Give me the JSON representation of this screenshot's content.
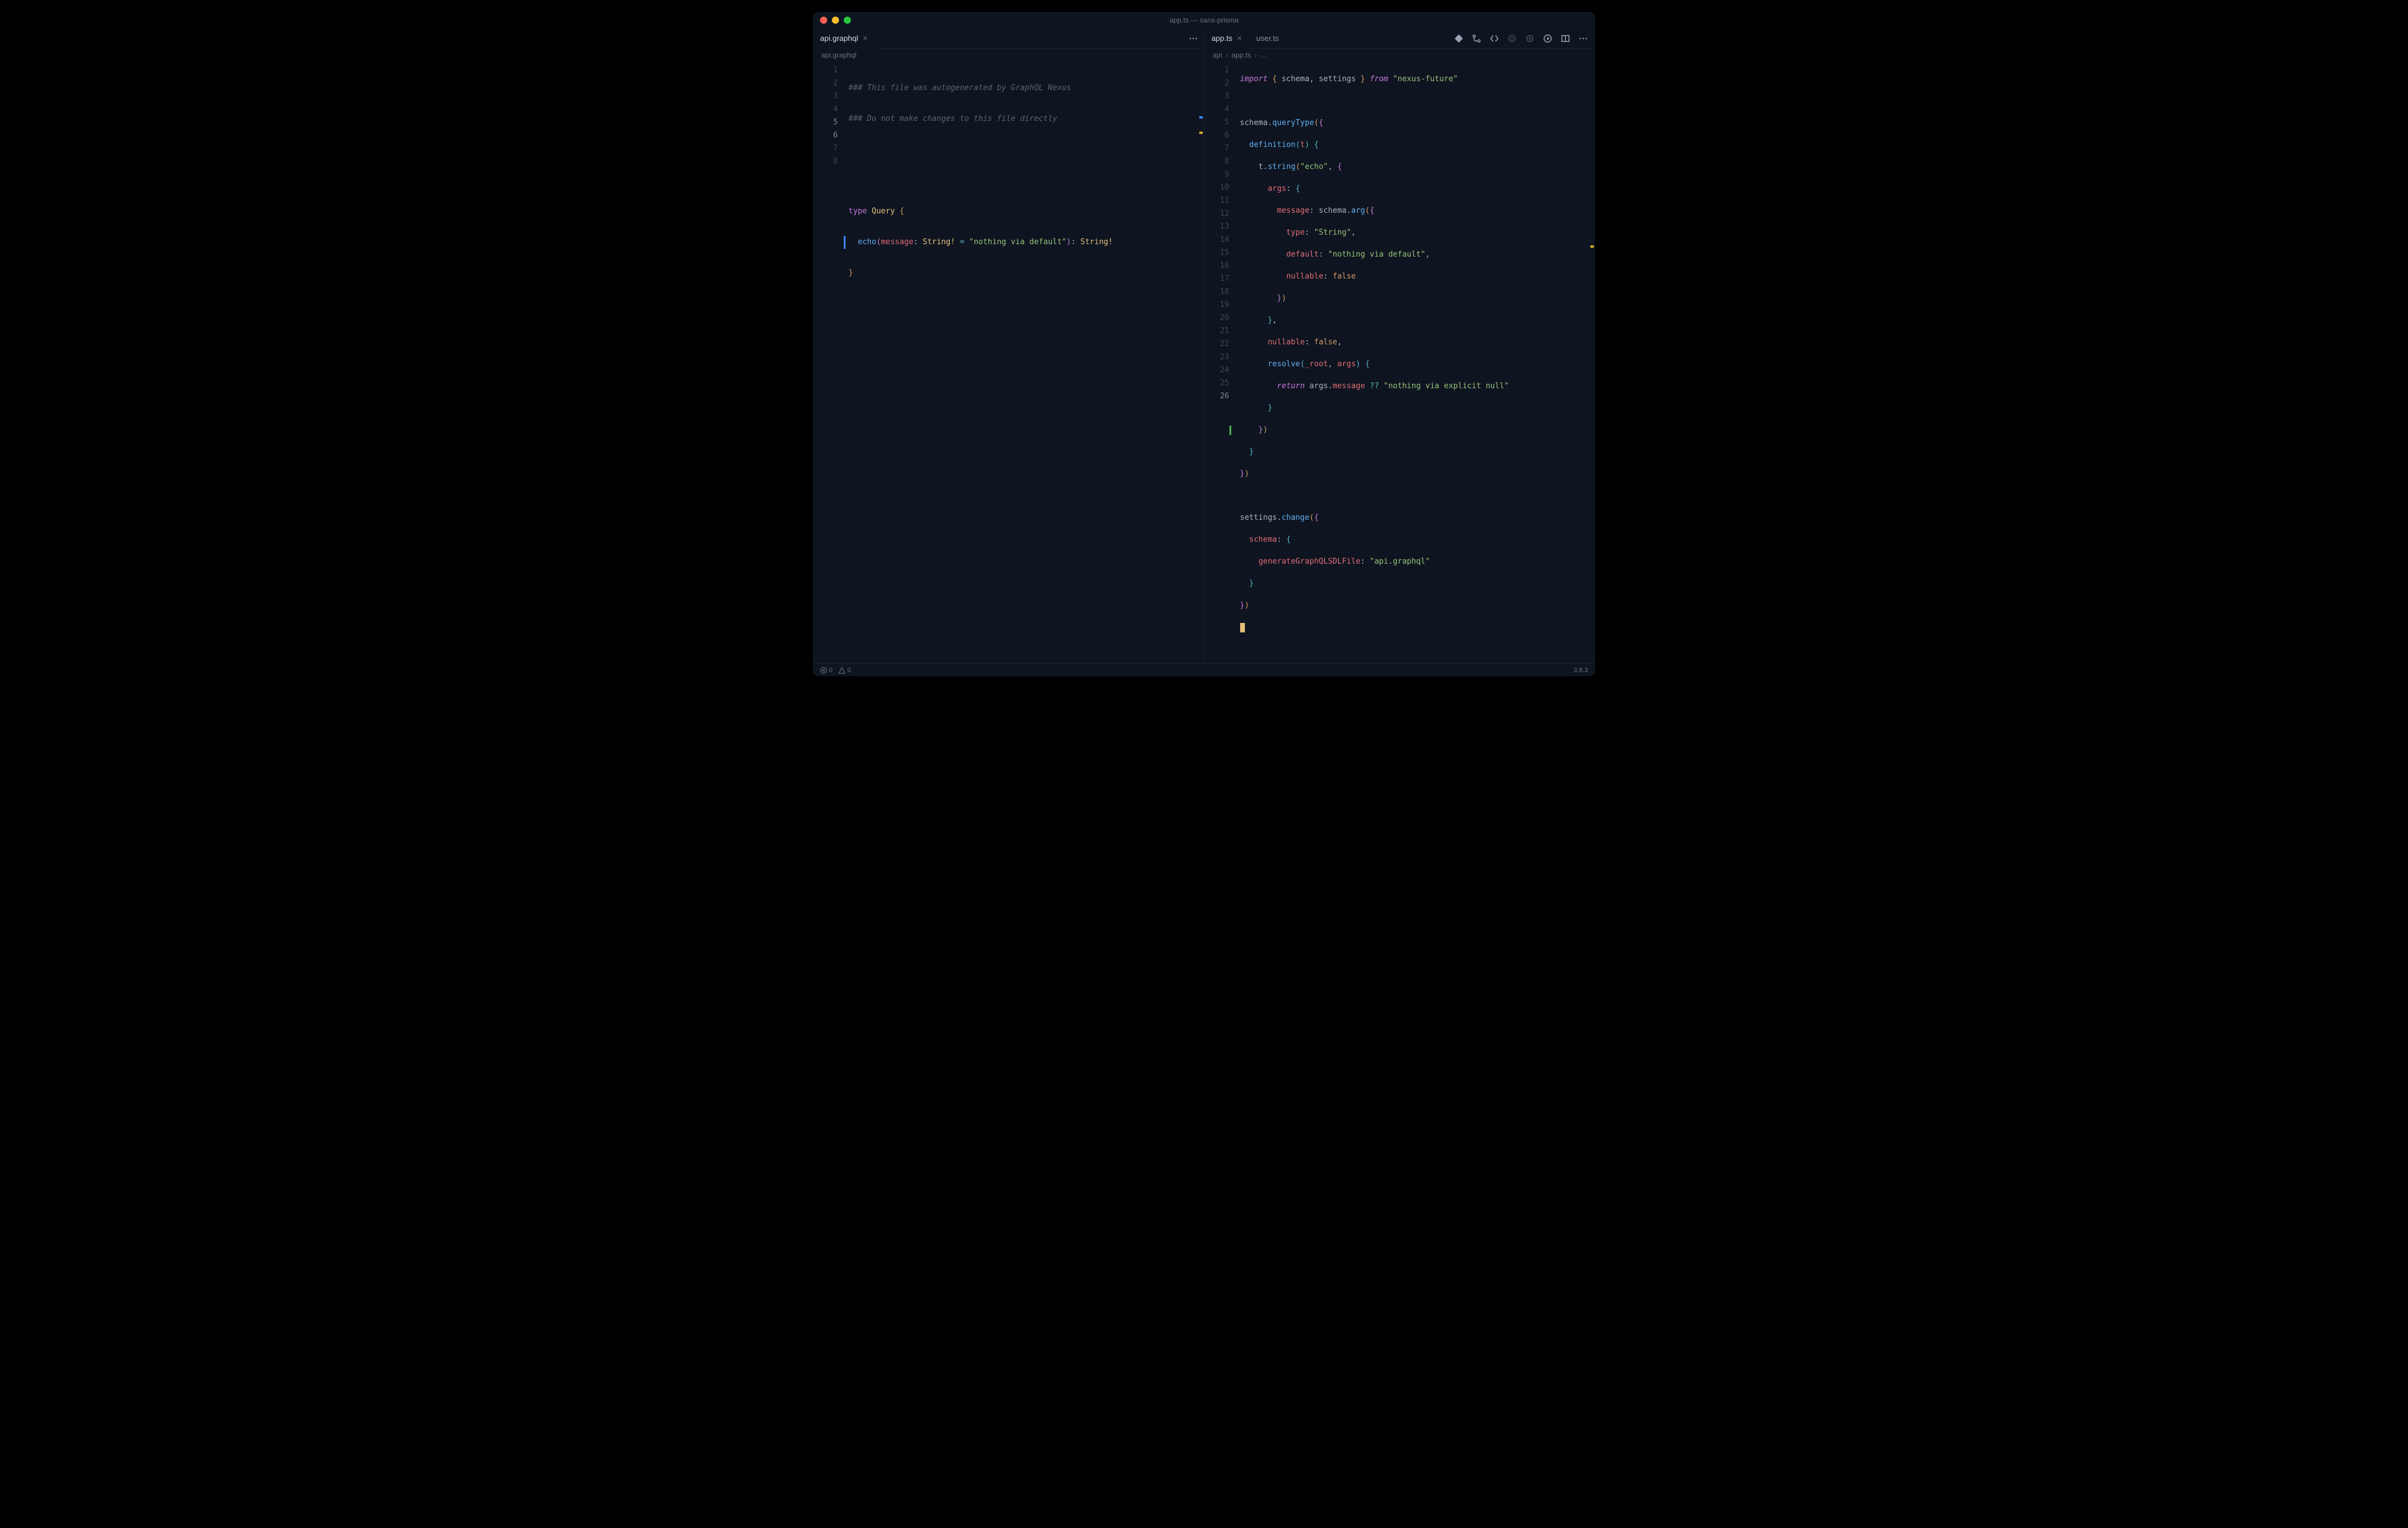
{
  "window": {
    "title": "app.ts — sans-prisma"
  },
  "leftPane": {
    "tabs": [
      {
        "label": "api.graphql",
        "active": true,
        "closeable": true
      }
    ],
    "breadcrumb": [
      "api.graphql"
    ],
    "lines": {
      "1": "### This file was autogenerated by GraphQL Nexus",
      "2": "### Do not make changes to this file directly",
      "3": "",
      "4": "",
      "5_kw": "type",
      "5_ident": "Query",
      "5_brace": "{",
      "6_fn": "echo",
      "6_open": "(",
      "6_prop": "message",
      "6_colon": ":",
      "6_type": "String!",
      "6_eq": "=",
      "6_str": "\"nothing via default\"",
      "6_close": ")",
      "6_colon2": ":",
      "6_ret": "String!",
      "7": "}",
      "8": ""
    },
    "lineCount": 8,
    "activeLine": 6
  },
  "rightPane": {
    "tabs": [
      {
        "label": "app.ts",
        "active": true,
        "closeable": true
      },
      {
        "label": "user.ts",
        "active": false,
        "closeable": false
      }
    ],
    "breadcrumb": [
      "api",
      "app.ts",
      "..."
    ],
    "lines": {
      "l1_import": "import",
      "l1_b1": "{",
      "l1_s": "schema",
      "l1_c": ",",
      "l1_set": "settings",
      "l1_b2": "}",
      "l1_from": "from",
      "l1_str": "\"nexus-future\"",
      "l3_v": "schema",
      "l3_d": ".",
      "l3_fn": "queryType",
      "l3_p1": "(",
      "l3_b": "{",
      "l4_fn": "definition",
      "l4_p1": "(",
      "l4_arg": "t",
      "l4_p2": ")",
      "l4_b": "{",
      "l5_v": "t",
      "l5_d": ".",
      "l5_fn": "string",
      "l5_p1": "(",
      "l5_str": "\"echo\"",
      "l5_c": ",",
      "l5_b": "{",
      "l6_prop": "args",
      "l6_c": ":",
      "l6_b": "{",
      "l7_prop": "message",
      "l7_c": ":",
      "l7_v": "schema",
      "l7_d": ".",
      "l7_fn": "arg",
      "l7_p1": "(",
      "l7_b": "{",
      "l8_prop": "type",
      "l8_c": ":",
      "l8_str": "\"String\"",
      "l8_cm": ",",
      "l9_prop": "default",
      "l9_c": ":",
      "l9_str": "\"nothing via default\"",
      "l9_cm": ",",
      "l10_prop": "nullable",
      "l10_c": ":",
      "l10_v": "false",
      "l11_b": "}",
      "l11_p": ")",
      "l12_b": "}",
      "l12_cm": ",",
      "l13_prop": "nullable",
      "l13_c": ":",
      "l13_v": "false",
      "l13_cm": ",",
      "l14_fn": "resolve",
      "l14_p1": "(",
      "l14_a1": "_root",
      "l14_cm": ",",
      "l14_a2": "args",
      "l14_p2": ")",
      "l14_b": "{",
      "l15_kw": "return",
      "l15_v": "args",
      "l15_d": ".",
      "l15_prop": "message",
      "l15_op": "??",
      "l15_str": "\"nothing via explicit null\"",
      "l16_b": "}",
      "l17_b": "}",
      "l17_p": ")",
      "l18_b": "}",
      "l19_b": "}",
      "l19_p": ")",
      "l21_v": "settings",
      "l21_d": ".",
      "l21_fn": "change",
      "l21_p1": "(",
      "l21_b": "{",
      "l22_prop": "schema",
      "l22_c": ":",
      "l22_b": "{",
      "l23_prop": "generateGraphQLSDLFile",
      "l23_c": ":",
      "l23_str": "\"api.graphql\"",
      "l24_b": "}",
      "l25_b": "}",
      "l25_p": ")"
    },
    "lineCount": 26
  },
  "statusbar": {
    "errors": "0",
    "warnings": "0",
    "version": "3.8.3"
  }
}
